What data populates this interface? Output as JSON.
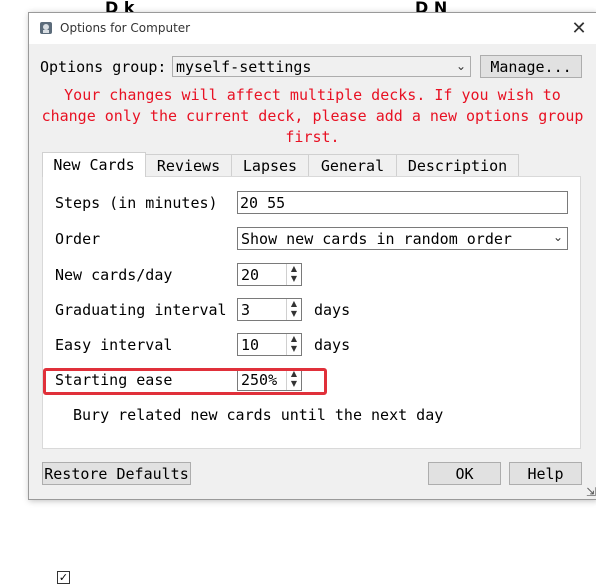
{
  "background": {
    "left_text": "D k",
    "right_text": "D  N"
  },
  "window": {
    "title": "Options for Computer",
    "close_glyph": "✕"
  },
  "options_group": {
    "label": "Options group:",
    "value": "myself-settings",
    "manage_label": "Manage..."
  },
  "warning": {
    "text": "Your changes will affect multiple decks. If you wish to change only the current deck, please add a new options group first.",
    "color": "#e81123"
  },
  "tabs": [
    {
      "label": "New Cards",
      "active": true
    },
    {
      "label": "Reviews",
      "active": false
    },
    {
      "label": "Lapses",
      "active": false
    },
    {
      "label": "General",
      "active": false
    },
    {
      "label": "Description",
      "active": false
    }
  ],
  "new_cards": {
    "steps": {
      "label": "Steps (in minutes)",
      "value": "20 55"
    },
    "order": {
      "label": "Order",
      "value": "Show new cards in random order"
    },
    "per_day": {
      "label": "New cards/day",
      "value": "20"
    },
    "graduating": {
      "label": "Graduating interval",
      "value": "3",
      "unit": "days"
    },
    "easy": {
      "label": "Easy interval",
      "value": "10",
      "unit": "days"
    },
    "starting_ease": {
      "label": "Starting ease",
      "value": "250%"
    },
    "bury": {
      "label": "Bury related new cards until the next day",
      "checked": true,
      "mark": "✓"
    }
  },
  "footer": {
    "restore_label": "Restore Defaults",
    "ok_label": "OK",
    "help_label": "Help"
  },
  "highlight_color": "#e0303a"
}
